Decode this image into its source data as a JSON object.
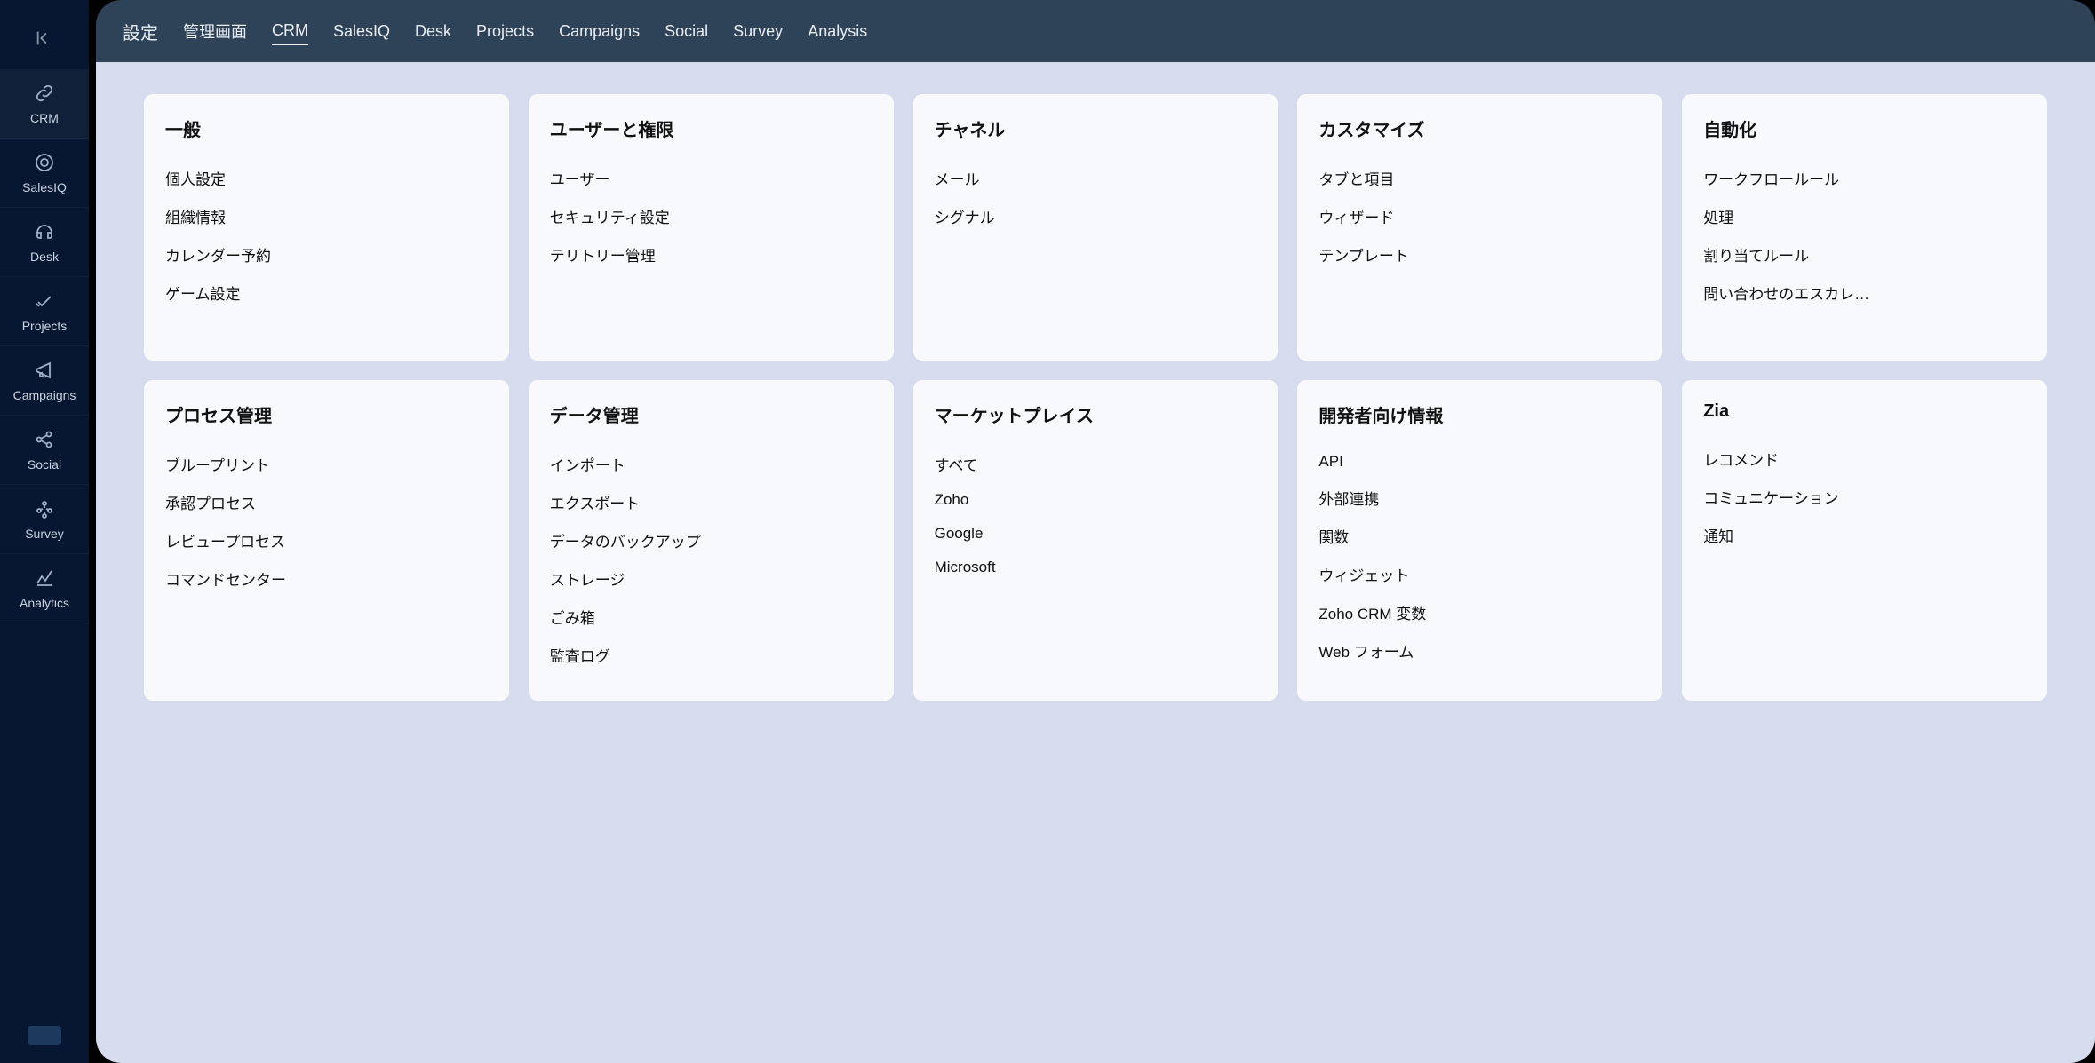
{
  "sidebar": {
    "items": [
      {
        "name": "crm",
        "label": "CRM",
        "icon": "link"
      },
      {
        "name": "salesiq",
        "label": "SalesIQ",
        "icon": "target"
      },
      {
        "name": "desk",
        "label": "Desk",
        "icon": "headset"
      },
      {
        "name": "projects",
        "label": "Projects",
        "icon": "check"
      },
      {
        "name": "campaigns",
        "label": "Campaigns",
        "icon": "megaphone"
      },
      {
        "name": "social",
        "label": "Social",
        "icon": "share"
      },
      {
        "name": "survey",
        "label": "Survey",
        "icon": "nodes"
      },
      {
        "name": "analytics",
        "label": "Analytics",
        "icon": "analytics"
      }
    ]
  },
  "header": {
    "title": "設定",
    "tabs": [
      {
        "label": "管理画面",
        "active": false
      },
      {
        "label": "CRM",
        "active": true
      },
      {
        "label": "SalesIQ",
        "active": false
      },
      {
        "label": "Desk",
        "active": false
      },
      {
        "label": "Projects",
        "active": false
      },
      {
        "label": "Campaigns",
        "active": false
      },
      {
        "label": "Social",
        "active": false
      },
      {
        "label": "Survey",
        "active": false
      },
      {
        "label": "Analysis",
        "active": false
      }
    ]
  },
  "cards": [
    {
      "title": "一般",
      "items": [
        "個人設定",
        "組織情報",
        "カレンダー予約",
        "ゲーム設定"
      ]
    },
    {
      "title": "ユーザーと権限",
      "items": [
        "ユーザー",
        "セキュリティ設定",
        "テリトリー管理"
      ]
    },
    {
      "title": "チャネル",
      "items": [
        "メール",
        "シグナル"
      ]
    },
    {
      "title": "カスタマイズ",
      "items": [
        "タブと項目",
        "ウィザード",
        "テンプレート"
      ]
    },
    {
      "title": "自動化",
      "items": [
        "ワークフロールール",
        "処理",
        "割り当てルール",
        "問い合わせのエスカレ…"
      ]
    },
    {
      "title": "プロセス管理",
      "items": [
        "ブループリント",
        "承認プロセス",
        "レビュープロセス",
        "コマンドセンター"
      ]
    },
    {
      "title": "データ管理",
      "items": [
        "インポート",
        "エクスポート",
        "データのバックアップ",
        "ストレージ",
        "ごみ箱",
        "監査ログ"
      ]
    },
    {
      "title": "マーケットプレイス",
      "items": [
        "すべて",
        "Zoho",
        "Google",
        "Microsoft"
      ]
    },
    {
      "title": "開発者向け情報",
      "items": [
        "API",
        "外部連携",
        "関数",
        "ウィジェット",
        "Zoho CRM 変数",
        "Web フォーム"
      ]
    },
    {
      "title": "Zia",
      "items": [
        "レコメンド",
        "コミュニケーション",
        "通知"
      ]
    }
  ]
}
